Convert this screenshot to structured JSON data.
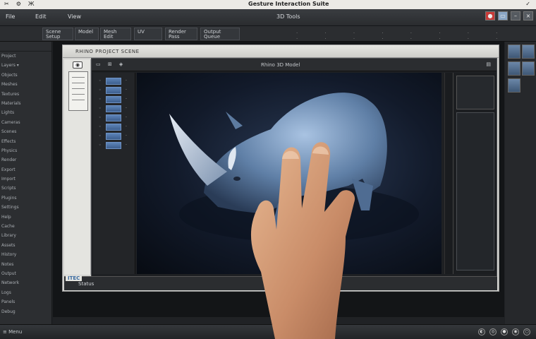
{
  "titlebar": {
    "left_items": [
      "✂",
      "⚙",
      "Ж"
    ],
    "title": "Gesture Interaction Suite",
    "right_icon": "✓"
  },
  "menubar": {
    "items": [
      "File",
      "Edit",
      "View"
    ],
    "center_label": "3D Tools"
  },
  "tabs": [
    {
      "label": "Scene\nSetup"
    },
    {
      "label": "Model"
    },
    {
      "label": "Mesh\nEdit"
    },
    {
      "label": "UV"
    },
    {
      "label": "Render\nPass"
    },
    {
      "label": "Output\nQueue"
    }
  ],
  "left_panel": {
    "items": [
      "Project",
      "Layers ▾",
      "Objects",
      "Meshes",
      "Textures",
      "Materials",
      "Lights",
      "Cameras",
      "Scenes",
      "Effects",
      "Physics",
      "Render",
      "Export",
      "Import",
      "Scripts",
      "Plugins",
      "Settings",
      "Help",
      "Cache",
      "Library",
      "Assets",
      "History",
      "Notes",
      "Output",
      "Network",
      "Logs",
      "Panels",
      "Debug"
    ]
  },
  "app": {
    "window_title": "RHINO PROJECT SCENE",
    "sidebar_icon": "◉",
    "toolbar_left": "▭ ⊞ ◈",
    "toolbar_title": "Rhino 3D Model",
    "toolbar_right": "▤",
    "layers_count": 8,
    "status_badge": "ITEC",
    "status_label": "Status",
    "accent": "#4f79ad"
  },
  "bottombar": {
    "left": "≡ Menu",
    "icons": [
      "◐",
      "◎",
      "●",
      "◉",
      "○"
    ]
  }
}
